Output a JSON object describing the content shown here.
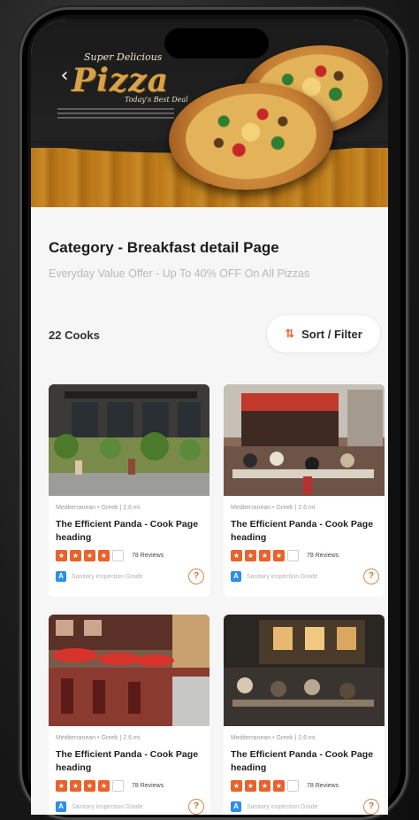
{
  "banner": {
    "logo_top": "Super Delicious",
    "logo_main": "Pizza",
    "logo_sub": "Today's Best Deal",
    "back_icon": "chevron-left-icon"
  },
  "header": {
    "title": "Category - Breakfast detail Page",
    "subtitle": "Everyday Value Offer - Up To 40% OFF On All Pizzas"
  },
  "toolbar": {
    "count_label": "22 Cooks",
    "sort_label": "Sort / Filter",
    "sort_icon": "filter-icon"
  },
  "cards": [
    {
      "meta": "Mediterranean • Greek | 2.6 mi",
      "title": "The Efficient Panda - Cook Page heading",
      "stars_filled": 4,
      "stars_total": 5,
      "reviews": "78 Reviews",
      "inspection": "Sanitary inspection Grade"
    },
    {
      "meta": "Mediterranean • Greek | 2.6 mi",
      "title": "The Efficient Panda - Cook Page heading",
      "stars_filled": 4,
      "stars_total": 5,
      "reviews": "78 Reviews",
      "inspection": "Sanitary inspection Grade"
    },
    {
      "meta": "Mediterranean • Greek | 2.6 mi",
      "title": "The Efficient Panda - Cook Page heading",
      "stars_filled": 4,
      "stars_total": 5,
      "reviews": "78 Reviews",
      "inspection": "Sanitary inspection Grade"
    },
    {
      "meta": "Mediterranean • Greek | 2.6 mi",
      "title": "The Efficient Panda - Cook Page heading",
      "stars_filled": 4,
      "stars_total": 5,
      "reviews": "78 Reviews",
      "inspection": "Sanitary inspection Grade"
    }
  ],
  "colors": {
    "accent": "#e8622c",
    "info_blue": "#2c8ee8",
    "banner_gold": "#d9a24a"
  }
}
